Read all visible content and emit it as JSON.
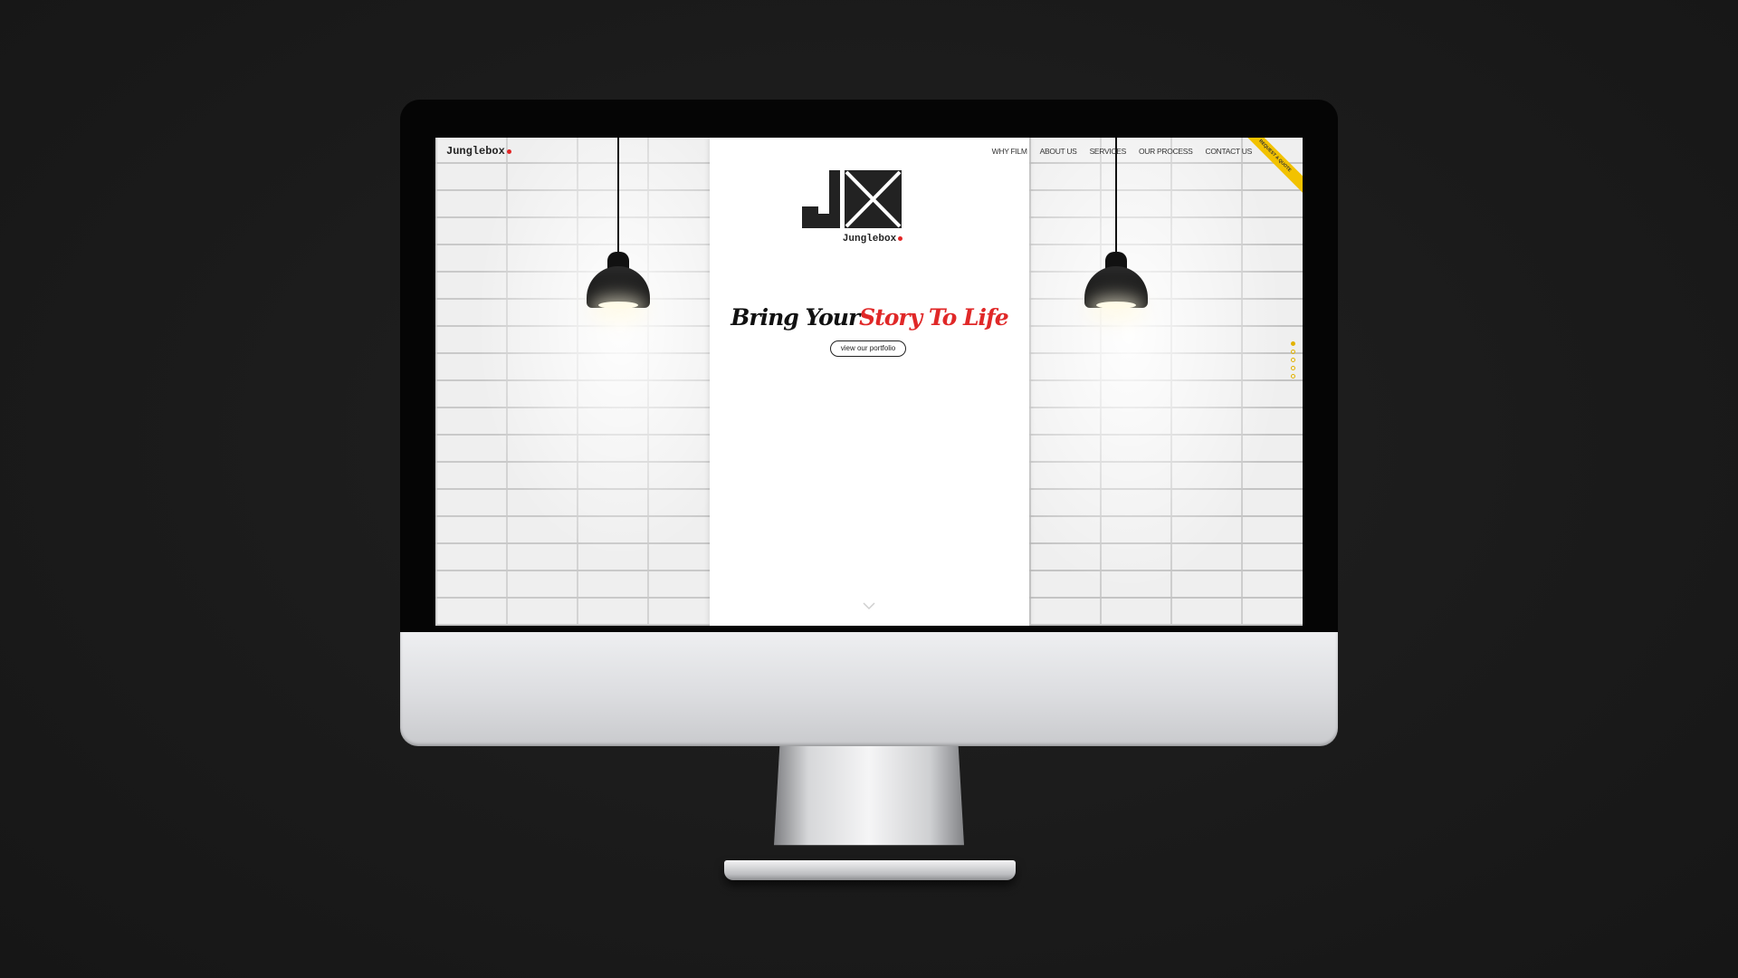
{
  "site": {
    "brand": "Junglebox",
    "logo_monogram": "JX",
    "logo_name": "Junglebox",
    "accent_red": "#e02828",
    "accent_yellow": "#f2c200"
  },
  "nav": {
    "items": [
      {
        "label": "WHY FILM"
      },
      {
        "label": "ABOUT US"
      },
      {
        "label": "SERVICES"
      },
      {
        "label": "OUR PROCESS"
      },
      {
        "label": "CONTACT US"
      }
    ],
    "ribbon_label": "REQUEST A QUOTE"
  },
  "hero": {
    "headline_dark": "Bring Your",
    "headline_red": "Story To Life",
    "button_label": "view our portfolio"
  },
  "icons": {
    "scroll": "chevron-down-icon",
    "pager": "pagination-dots"
  }
}
